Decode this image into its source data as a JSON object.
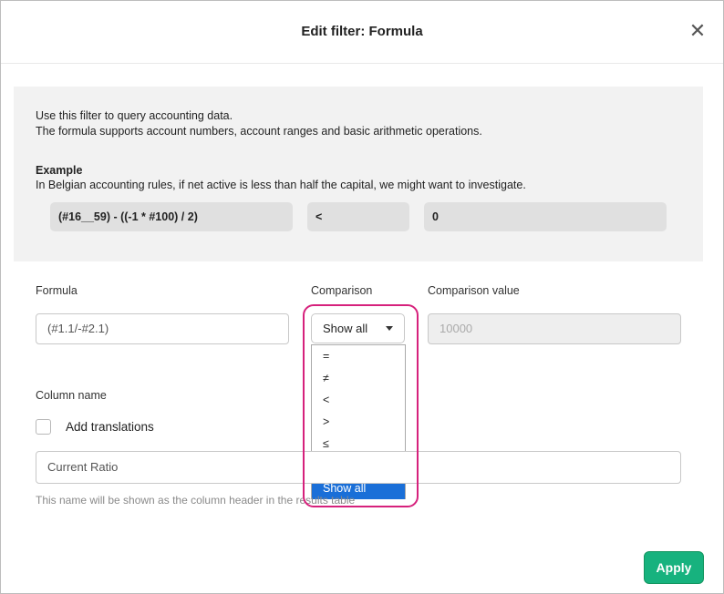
{
  "dialog": {
    "title": "Edit filter: Formula",
    "close_glyph": "✕"
  },
  "info": {
    "line1": "Use this filter to query accounting data.",
    "line2": "The formula supports account numbers, account ranges and basic arithmetic operations.",
    "example_heading": "Example",
    "example_text": "In Belgian accounting rules, if net active is less than half the capital, we might want to investigate.",
    "example_formula": "(#16__59) - ((-1 * #100) / 2)",
    "example_comparison": "<",
    "example_value": "0"
  },
  "form": {
    "formula_label": "Formula",
    "formula_value": "(#1.1/-#2.1)",
    "comparison_label": "Comparison",
    "comparison_selected": "Show all",
    "comparison_value_label": "Comparison value",
    "comparison_value_placeholder": "10000",
    "comparison_options": [
      "=",
      "≠",
      "<",
      ">",
      "≤",
      "≥",
      "Show all"
    ],
    "column_name_label": "Column name",
    "add_translations_label": "Add translations",
    "add_translations_checked": false,
    "column_name_value": "Current Ratio",
    "column_name_hint": "This name will be shown as the column header in the results table"
  },
  "footer": {
    "apply_label": "Apply"
  },
  "colors": {
    "apply": "#17b27e",
    "highlight": "#d6217c",
    "selected_option": "#1a6fd8"
  }
}
